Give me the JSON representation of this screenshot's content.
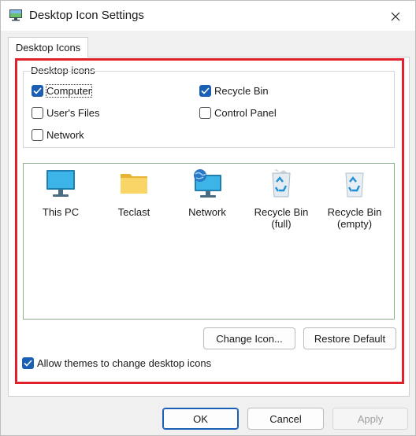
{
  "window": {
    "title": "Desktop Icon Settings"
  },
  "tab": {
    "label": "Desktop Icons"
  },
  "group": {
    "legend": "Desktop icons",
    "checkboxes": [
      {
        "label": "Computer",
        "checked": true
      },
      {
        "label": "Recycle Bin",
        "checked": true
      },
      {
        "label": "User's Files",
        "checked": false
      },
      {
        "label": "Control Panel",
        "checked": false
      },
      {
        "label": "Network",
        "checked": false
      }
    ]
  },
  "icons": [
    {
      "label": "This PC",
      "icon": "monitor-icon"
    },
    {
      "label": "Teclast",
      "icon": "folder-icon"
    },
    {
      "label": "Network",
      "icon": "network-icon"
    },
    {
      "label": "Recycle Bin",
      "label2": "(full)",
      "icon": "recycle-bin-full-icon"
    },
    {
      "label": "Recycle Bin",
      "label2": "(empty)",
      "icon": "recycle-bin-empty-icon"
    }
  ],
  "buttons": {
    "change_icon": "Change Icon...",
    "restore_default": "Restore Default",
    "ok": "OK",
    "cancel": "Cancel",
    "apply": "Apply"
  },
  "allow_themes": {
    "label": "Allow themes to change desktop icons",
    "checked": true
  },
  "colors": {
    "accent": "#1a5fb4",
    "highlight": "#e0202a"
  }
}
